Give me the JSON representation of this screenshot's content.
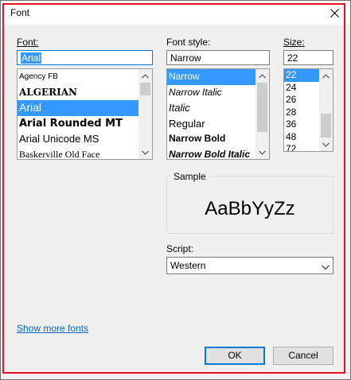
{
  "window": {
    "title": "Font"
  },
  "font": {
    "label": "Font:",
    "value": "Arial",
    "items": [
      {
        "label": "Agency FB",
        "family": "\"Liberation Sans Narrow\", \"Liberation Sans\", sans-serif",
        "size": "10px",
        "weight": "normal",
        "style": "normal"
      },
      {
        "label": "ALGERIAN",
        "family": "\"DejaVu Serif\", serif",
        "size": "12px",
        "weight": "bold",
        "style": "normal"
      },
      {
        "label": "Arial",
        "family": "\"Liberation Sans\", sans-serif",
        "size": "14px",
        "weight": "normal",
        "style": "normal",
        "selected": true
      },
      {
        "label": "Arial Rounded MT",
        "family": "\"DejaVu Sans\", sans-serif",
        "size": "13px",
        "weight": "bold",
        "style": "normal"
      },
      {
        "label": "Arial Unicode MS",
        "family": "\"Liberation Sans\", sans-serif",
        "size": "13px",
        "weight": "normal",
        "style": "normal"
      },
      {
        "label": "Baskerville Old Face",
        "family": "\"Liberation Serif\", serif",
        "size": "12px",
        "weight": "normal",
        "style": "normal"
      }
    ]
  },
  "style": {
    "label": "Font style:",
    "value": "Narrow",
    "items": [
      {
        "label": "Narrow",
        "size": "12px",
        "weight": "normal",
        "style": "normal",
        "selected": true
      },
      {
        "label": "Narrow Italic",
        "size": "12px",
        "weight": "normal",
        "style": "italic"
      },
      {
        "label": "Italic",
        "size": "13px",
        "weight": "normal",
        "style": "italic"
      },
      {
        "label": "Regular",
        "size": "13px",
        "weight": "normal",
        "style": "normal"
      },
      {
        "label": "Narrow Bold",
        "size": "12px",
        "weight": "bold",
        "style": "normal"
      },
      {
        "label": "Narrow Bold Italic",
        "size": "12px",
        "weight": "bold",
        "style": "italic"
      }
    ]
  },
  "size": {
    "label": "Size:",
    "value": "22",
    "items": [
      "22",
      "24",
      "26",
      "28",
      "36",
      "48",
      "72"
    ],
    "selected": "22"
  },
  "sample": {
    "label": "Sample",
    "text": "AaBbYyZz"
  },
  "script": {
    "label": "Script:",
    "value": "Western"
  },
  "show_more": "Show more fonts",
  "buttons": {
    "ok": "OK",
    "cancel": "Cancel"
  },
  "colors": {
    "accent": "#0078d7",
    "selection": "#3399ff",
    "link": "#0066cc",
    "frame": "#e81123"
  }
}
